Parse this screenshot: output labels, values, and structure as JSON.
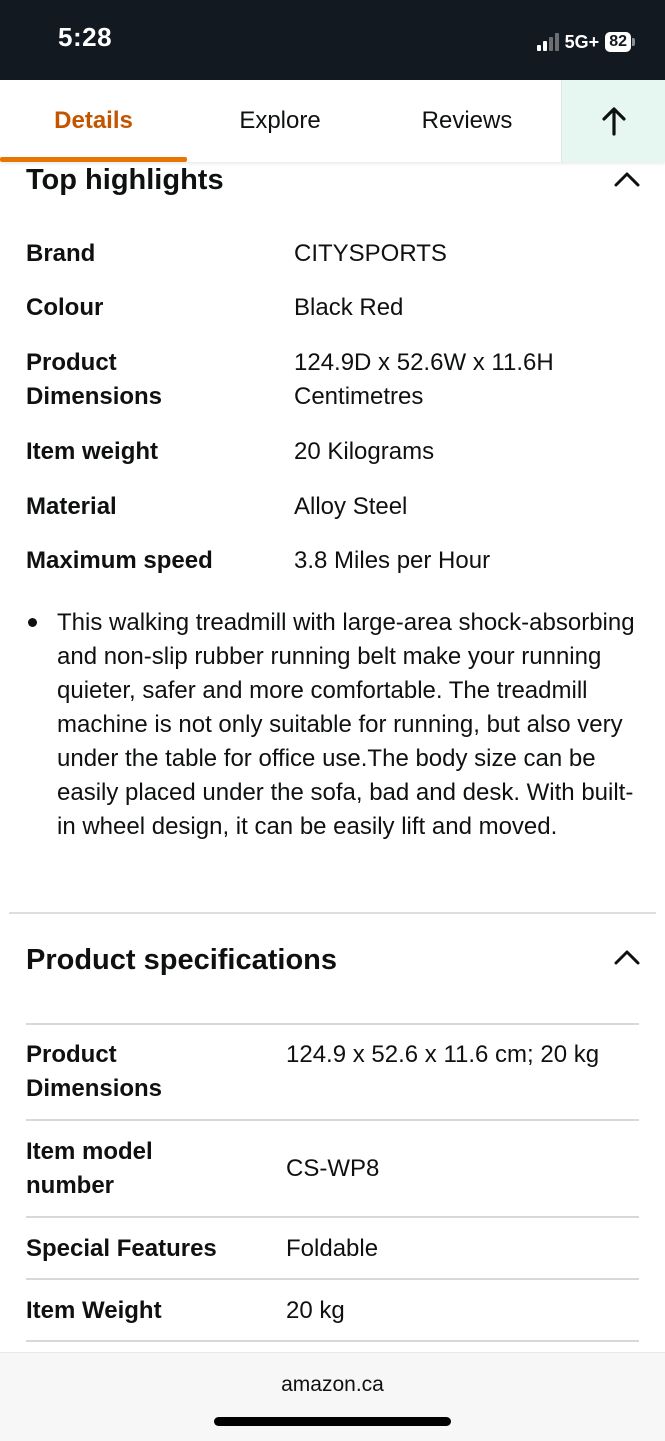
{
  "status_bar": {
    "time": "5:28",
    "network": "5G+",
    "battery": "82"
  },
  "tabs": [
    {
      "label": "Details",
      "active": true
    },
    {
      "label": "Explore",
      "active": false
    },
    {
      "label": "Reviews",
      "active": false
    }
  ],
  "back_to_top_icon": "arrow-up-icon",
  "top_highlights": {
    "title": "Top highlights",
    "rows": [
      {
        "label": "Brand",
        "value": "CITYSPORTS"
      },
      {
        "label": "Colour",
        "value": "Black Red"
      },
      {
        "label": "Product Dimensions",
        "value": "124.9D x 52.6W x 11.6H Centimetres"
      },
      {
        "label": "Item weight",
        "value": "20 Kilograms"
      },
      {
        "label": "Material",
        "value": "Alloy Steel"
      },
      {
        "label": "Maximum speed",
        "value": "3.8 Miles per Hour"
      }
    ],
    "bullets": [
      "This walking treadmill with large-area shock-absorbing and non-slip rubber running belt make your running quieter, safer and more comfortable. The treadmill machine is not only suitable for running, but also very under the table for office use.The body size can be easily placed under the sofa, bad and desk. With built-in wheel design, it can be easily lift and moved."
    ]
  },
  "product_specifications": {
    "title": "Product specifications",
    "rows": [
      {
        "label": "Product Dimensions",
        "value": "124.9 x 52.6 x 11.6 cm; 20 kg"
      },
      {
        "label": "Item model number",
        "value": "CS-WP8"
      },
      {
        "label": "Special Features",
        "value": "Foldable"
      },
      {
        "label": "Item Weight",
        "value": "20 kg"
      }
    ]
  },
  "bottom_bar": {
    "domain": "amazon.ca"
  },
  "colors": {
    "status_bar_bg": "#131921",
    "active_tab_text": "#c45500",
    "active_tab_indicator": "#e77600",
    "back_to_top_bg": "#e6f7f2"
  }
}
